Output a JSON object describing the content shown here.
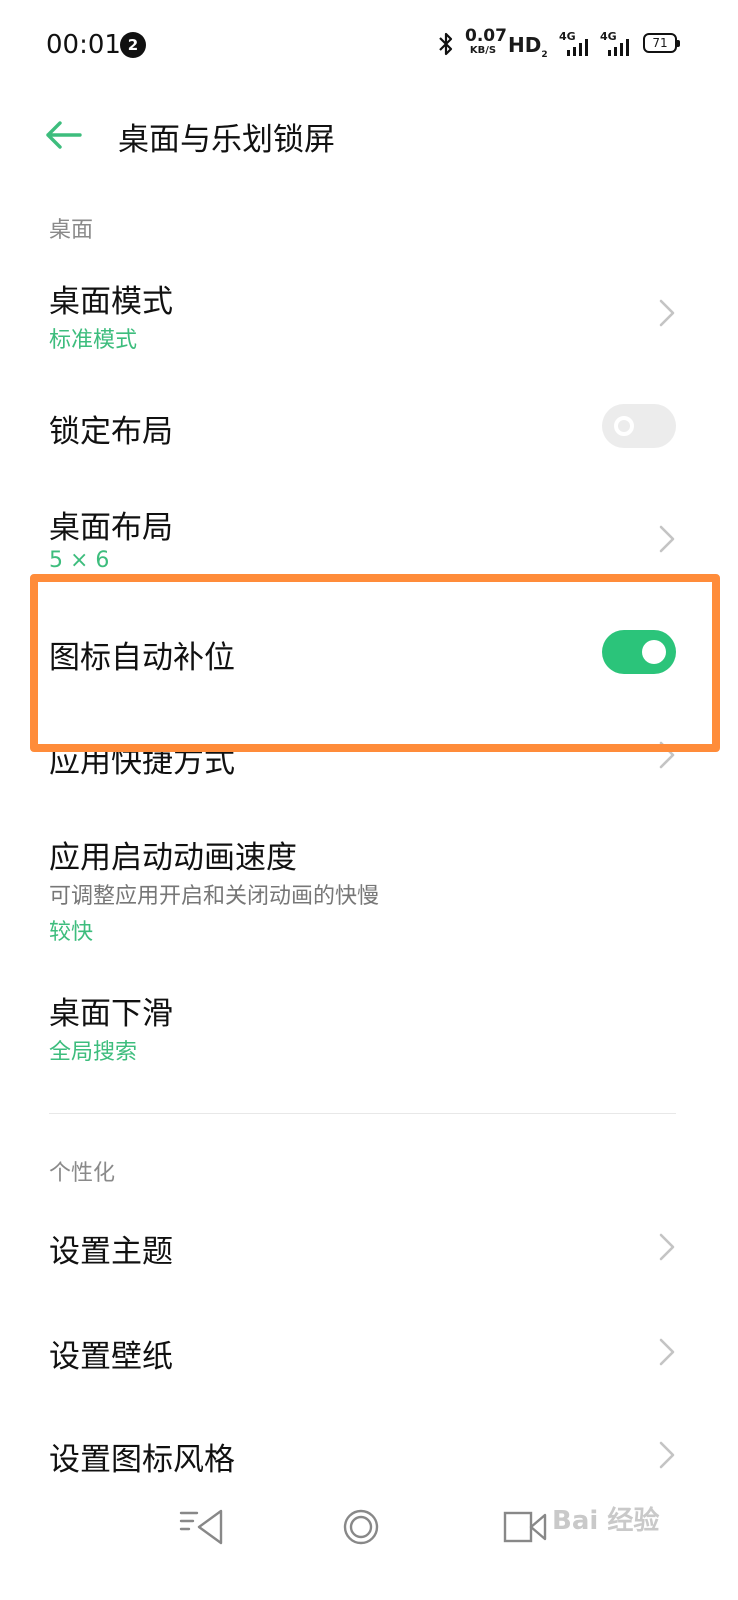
{
  "status_bar": {
    "time": "00:01",
    "notification_count": "2",
    "net_speed_value": "0.07",
    "net_speed_unit": "KB/S",
    "hd_label": "HD",
    "hd_sub": "2",
    "signal_1_type": "4G",
    "signal_2_type": "4G",
    "battery": "71"
  },
  "header": {
    "title": "桌面与乐划锁屏"
  },
  "sections": {
    "desktop": {
      "header": "桌面"
    },
    "personalize": {
      "header": "个性化"
    }
  },
  "rows": {
    "desktop_mode": {
      "title": "桌面模式",
      "value": "标准模式"
    },
    "lock_layout": {
      "title": "锁定布局",
      "toggle": "off"
    },
    "desktop_layout": {
      "title": "桌面布局",
      "value": "5 × 6"
    },
    "auto_fill_icons": {
      "title": "图标自动补位",
      "toggle": "on"
    },
    "app_shortcuts": {
      "title": "应用快捷方式"
    },
    "launch_animation_speed": {
      "title": "应用启动动画速度",
      "description": "可调整应用开启和关闭动画的快慢",
      "value": "较快"
    },
    "desktop_swipe_down": {
      "title": "桌面下滑",
      "value": "全局搜索"
    },
    "set_theme": {
      "title": "设置主题"
    },
    "set_wallpaper": {
      "title": "设置壁纸"
    },
    "set_icon_style": {
      "title": "设置图标风格"
    }
  },
  "watermark": "Bai 经验",
  "colors": {
    "accent": "#3dbd7d",
    "toggle_on": "#2bc47a",
    "highlight": "#ff8c3a"
  },
  "icons": [
    "back-arrow-icon",
    "chevron-right-icon",
    "bluetooth-icon",
    "battery-icon",
    "signal-icon",
    "nav-back-icon",
    "nav-home-icon",
    "nav-recents-icon"
  ]
}
